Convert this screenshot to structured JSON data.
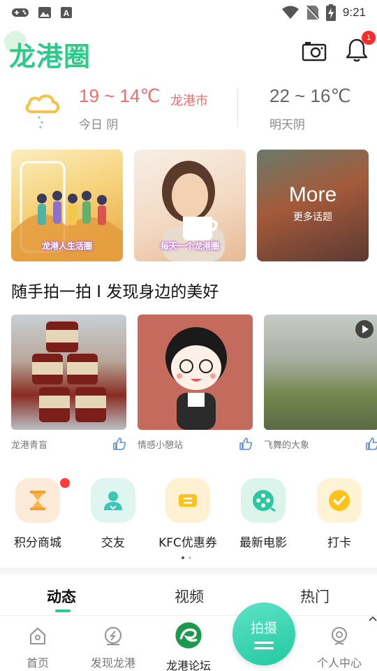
{
  "status_bar": {
    "time": "9:21",
    "icons": [
      "game-controller-icon",
      "image-icon",
      "font-icon",
      "wifi-icon",
      "no-sim-icon",
      "battery-charging-icon"
    ]
  },
  "header": {
    "logo_text": "龙港圈",
    "notification_count": "1",
    "accent_color": "#2ccb8a"
  },
  "weather": {
    "today_temp": "19 ~ 14℃",
    "city": "龙港市",
    "today_label": "今日 阴",
    "tomorrow_temp": "22 ~ 16℃",
    "tomorrow_label": "明天阴"
  },
  "topics": [
    {
      "caption": "龙港人生活圈"
    },
    {
      "caption": "每天一个龙港圈"
    },
    {
      "title": "More",
      "subtitle": "更多话题"
    }
  ],
  "section_title": "随手拍一拍 I 发现身边的美好",
  "photos": [
    {
      "author": "龙港青盲"
    },
    {
      "author": "情感小憩站"
    },
    {
      "author": "飞舞的大象"
    }
  ],
  "quick_menu": [
    {
      "label": "积分商城",
      "icon": "hourglass-icon",
      "color": "#ffb347"
    },
    {
      "label": "交友",
      "icon": "person-icon",
      "color": "#3cc6b8"
    },
    {
      "label": "KFC优惠券",
      "icon": "coupon-icon",
      "color": "#ffc21a"
    },
    {
      "label": "最新电影",
      "icon": "film-reel-icon",
      "color": "#2cc6a0"
    },
    {
      "label": "打卡",
      "icon": "checkmark-icon",
      "color": "#ffc21a"
    }
  ],
  "feed_tabs": [
    "动态",
    "视频",
    "热门"
  ],
  "bottom_nav": [
    {
      "label": "首页"
    },
    {
      "label": "发现龙港"
    },
    {
      "label": "龙港论坛"
    },
    {
      "label": "个人中心"
    }
  ],
  "shoot_label": "拍摄"
}
